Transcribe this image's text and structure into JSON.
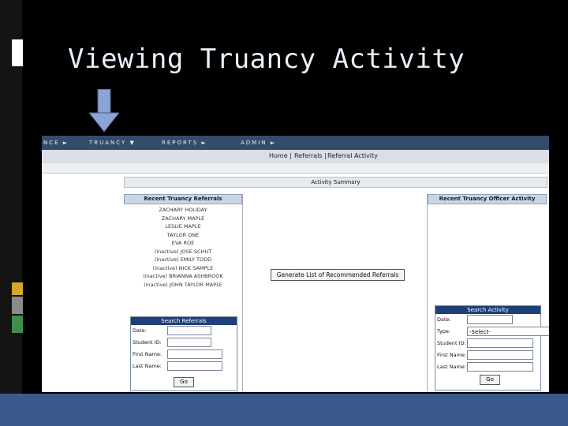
{
  "slide": {
    "title": "Viewing Truancy Activity",
    "colors": {
      "background": "#000000",
      "title": "#e6f0fb",
      "arrow": "#8aa4d6",
      "footer": "#3a5a8e"
    }
  },
  "app": {
    "nav": [
      {
        "label": "NCE ►"
      },
      {
        "label": "TRUANCY ▼"
      },
      {
        "label": "REPORTS ►"
      },
      {
        "label": "ADMIN ►"
      }
    ],
    "breadcrumb": [
      "Home |",
      "Referrals |",
      "Referral Activity"
    ],
    "summary_label": "Activity Summary",
    "recent_referrals": {
      "title": "Recent Truancy Referrals",
      "items": [
        "ZACHARY HOLIDAY",
        "ZACHARY MAPLE",
        "LESLIE MAPLE",
        "TAYLOR ONE",
        "EVA ROE",
        "(inactive) JOSE SCHUT",
        "(inactive) EMILY TODD",
        "(inactive) NICK SAMPLE",
        "(inactive) BRIANNA ASHBROOK",
        "(inactive) JOHN TAYLOR MAPLE"
      ]
    },
    "generate_button": "Generate List of Recommended Referrals",
    "recent_officer_activity": {
      "title": "Recent Truancy Officer Activity"
    },
    "search_referrals": {
      "title": "Search Referrals",
      "fields": [
        "Date:",
        "Student ID:",
        "First Name:",
        "Last Name:"
      ],
      "go": "Go"
    },
    "search_activity": {
      "title": "Search Activity",
      "fields": [
        "Date:",
        "Type:",
        "Student ID:",
        "First Name:",
        "Last Name:"
      ],
      "type_value": "-Select-",
      "go": "Go"
    }
  }
}
